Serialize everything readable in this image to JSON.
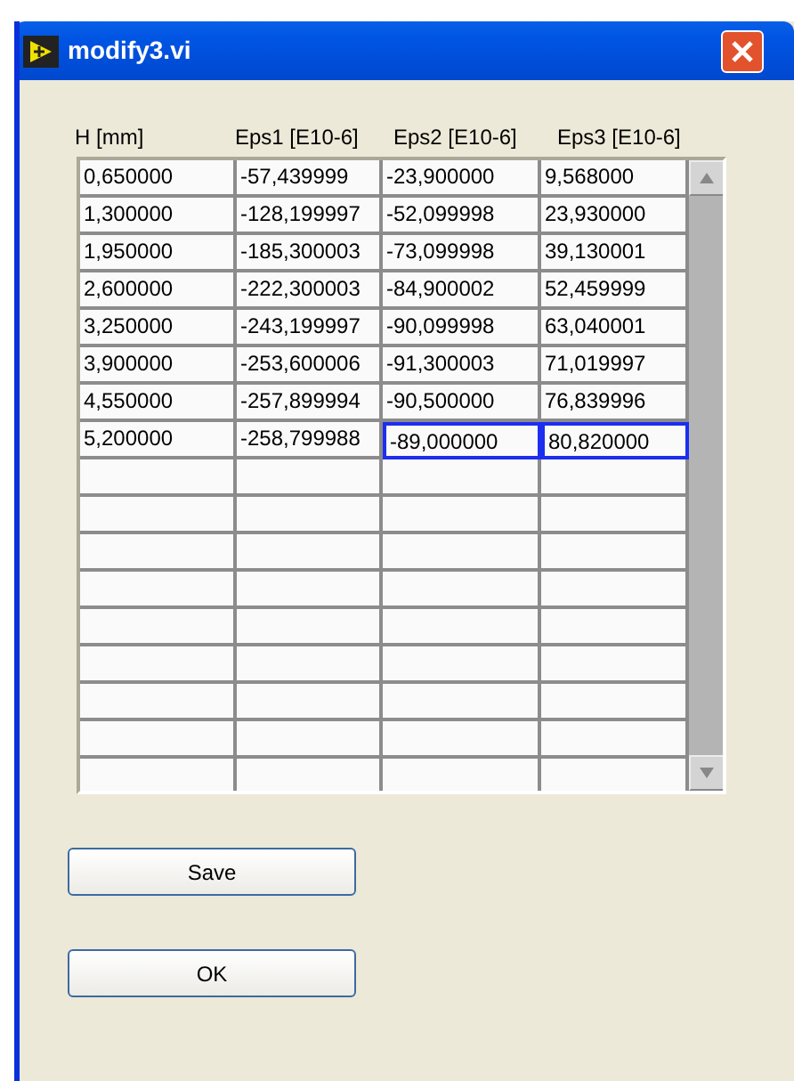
{
  "window": {
    "title": "modify3.vi"
  },
  "table": {
    "columns": [
      "H  [mm]",
      "Eps1 [E10-6]",
      "Eps2 [E10-6]",
      "Eps3 [E10-6]"
    ],
    "rows": [
      [
        {
          "text": "0,650000",
          "selected": false
        },
        {
          "text": "-57,439999",
          "selected": false
        },
        {
          "text": "-23,900000",
          "selected": false
        },
        {
          "text": "9,568000",
          "selected": false
        }
      ],
      [
        {
          "text": "1,300000",
          "selected": false
        },
        {
          "text": "-128,199997",
          "selected": false
        },
        {
          "text": "-52,099998",
          "selected": false
        },
        {
          "text": "23,930000",
          "selected": false
        }
      ],
      [
        {
          "text": "1,950000",
          "selected": false
        },
        {
          "text": "-185,300003",
          "selected": false
        },
        {
          "text": "-73,099998",
          "selected": false
        },
        {
          "text": "39,130001",
          "selected": false
        }
      ],
      [
        {
          "text": "2,600000",
          "selected": false
        },
        {
          "text": "-222,300003",
          "selected": false
        },
        {
          "text": "-84,900002",
          "selected": false
        },
        {
          "text": "52,459999",
          "selected": false
        }
      ],
      [
        {
          "text": "3,250000",
          "selected": false
        },
        {
          "text": "-243,199997",
          "selected": false
        },
        {
          "text": "-90,099998",
          "selected": false
        },
        {
          "text": "63,040001",
          "selected": false
        }
      ],
      [
        {
          "text": "3,900000",
          "selected": false
        },
        {
          "text": "-253,600006",
          "selected": false
        },
        {
          "text": "-91,300003",
          "selected": false
        },
        {
          "text": "71,019997",
          "selected": false
        }
      ],
      [
        {
          "text": "4,550000",
          "selected": false
        },
        {
          "text": "-257,899994",
          "selected": false
        },
        {
          "text": "-90,500000",
          "selected": false
        },
        {
          "text": "76,839996",
          "selected": false
        }
      ],
      [
        {
          "text": "5,200000",
          "selected": false
        },
        {
          "text": "-258,799988",
          "selected": false
        },
        {
          "text": "-89,000000",
          "selected": true
        },
        {
          "text": "80,820000",
          "selected": true
        }
      ]
    ]
  },
  "buttons": [
    "Save",
    "OK"
  ]
}
